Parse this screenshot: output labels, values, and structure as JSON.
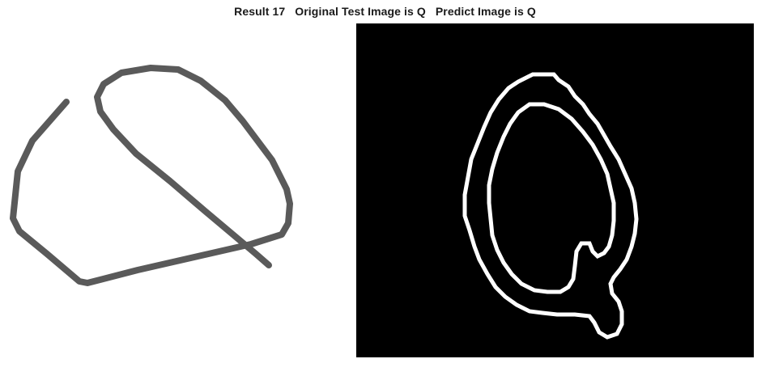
{
  "figure": {
    "title": "Result 17   Original Test Image is Q   Predict Image is Q"
  },
  "panels": {
    "original": {
      "icon": "handwritten-letter-sketch",
      "stroke_color": "#5a5a5a",
      "background_color": "#ffffff"
    },
    "processed": {
      "icon": "edge-outline-letter",
      "stroke_color": "#ffffff",
      "background_color": "#000000"
    }
  }
}
